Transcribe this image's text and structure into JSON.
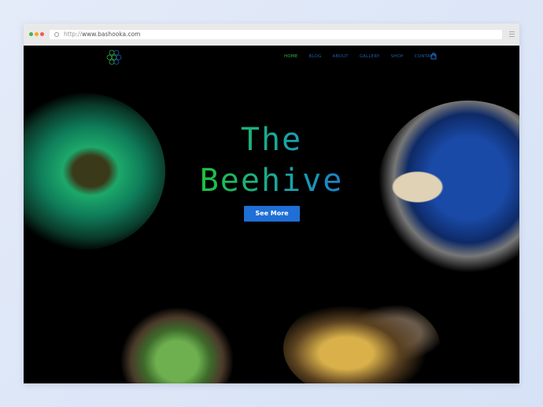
{
  "browser": {
    "url_prefix": "http://",
    "url_domain": "www.bashooka.com",
    "traffic_lights": [
      "#4caf50",
      "#f5a623",
      "#f25a4c"
    ]
  },
  "nav": {
    "items": [
      {
        "label": "HOME",
        "active": true
      },
      {
        "label": "BLOG"
      },
      {
        "label": "ABOUT"
      },
      {
        "label": "GALLERY"
      },
      {
        "label": "SHOP"
      },
      {
        "label": "CONTACT"
      }
    ],
    "cart_icon": "shopping-bag-icon"
  },
  "hero": {
    "title_line1": "The",
    "title_line2": "Beehive",
    "button_label": "See More"
  },
  "colors": {
    "accent": "#1f6fd6",
    "green": "#2fb34a"
  }
}
